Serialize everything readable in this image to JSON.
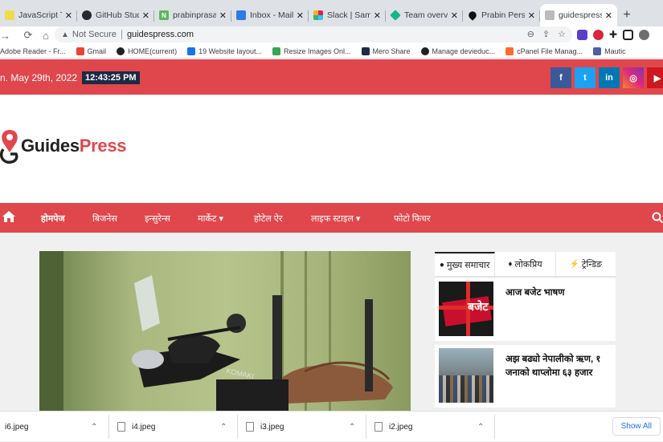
{
  "tabs": [
    {
      "title": "JavaScript Tu",
      "icon": "javascript-icon",
      "color": "#f0db4f"
    },
    {
      "title": "GitHub Stude",
      "icon": "github-icon",
      "color": "#24292e"
    },
    {
      "title": "prabinprasain",
      "icon": "notion-icon",
      "color": "#5cb85c"
    },
    {
      "title": "Inbox - Mail",
      "icon": "mail-icon",
      "color": "#2d7be5"
    },
    {
      "title": "Slack | Samye",
      "icon": "slack-icon",
      "color": "#e01e5a"
    },
    {
      "title": "Team overvie",
      "icon": "diamond-icon",
      "color": "#19b48a"
    },
    {
      "title": "Prabin Person",
      "icon": "drop-icon",
      "color": "#111111"
    },
    {
      "title": "guidespress.c",
      "icon": "guidespress-icon",
      "color": "#7a7a7a",
      "active": true
    }
  ],
  "address": {
    "security": "Not Secure",
    "url": "guidespress.com"
  },
  "bookmarks": [
    {
      "label": "Adobe Reader - Fr...",
      "color": "#d93025"
    },
    {
      "label": "Gmail",
      "color": "#ea4335"
    },
    {
      "label": "HOME(current)",
      "color": "#202124"
    },
    {
      "label": "19 Website layout...",
      "color": "#1a73e8"
    },
    {
      "label": "Resize Images Onl...",
      "color": "#34a853"
    },
    {
      "label": "Mero Share",
      "color": "#1c2a44"
    },
    {
      "label": "Manage devieduc...",
      "color": "#202124"
    },
    {
      "label": "cPanel File Manag...",
      "color": "#ff6c2c"
    },
    {
      "label": "Mautic",
      "color": "#4e5e9e"
    }
  ],
  "topbar": {
    "date": "n. May 29th, 2022",
    "time": "12:43:25 PM"
  },
  "social": [
    {
      "name": "facebook",
      "glyph": "f",
      "color": "#3b5998"
    },
    {
      "name": "twitter",
      "glyph": "t",
      "color": "#1da1f2"
    },
    {
      "name": "linkedin",
      "glyph": "in",
      "color": "#0077b5"
    },
    {
      "name": "instagram",
      "glyph": "◎",
      "color": "#c13584"
    },
    {
      "name": "youtube",
      "glyph": "▶",
      "color": "#cc181e"
    }
  ],
  "logo": {
    "part1": "Guides",
    "part2": "Press"
  },
  "nav": {
    "items": [
      {
        "label": "होमपेज",
        "bold": true
      },
      {
        "label": "बिजनेस"
      },
      {
        "label": "इन्सुरेन्स"
      },
      {
        "label": "मार्केट ▾"
      },
      {
        "label": "होटेल ऐर"
      },
      {
        "label": "लाइफ स्टाइल ▾"
      },
      {
        "label": "फोटो फिचर"
      }
    ]
  },
  "sidebar": {
    "tabs": [
      {
        "label": "मुख्य समाचार",
        "icon": "clock-icon"
      },
      {
        "label": "लोकप्रिय",
        "icon": "fire-icon"
      },
      {
        "label": "ट्रेन्डिङ",
        "icon": "bolt-icon"
      }
    ],
    "news": [
      {
        "title": "आज बजेट भाषण",
        "thumb_text": "बजेट"
      },
      {
        "title": "अझ बढ्यो नेपालीको ऋण, १ जनाको थाप्लोमा ६३ हजार"
      }
    ]
  },
  "downloads": {
    "files": [
      "i6.jpeg",
      "i4.jpeg",
      "i3.jpeg",
      "i2.jpeg"
    ],
    "show_all": "Show All"
  },
  "colors": {
    "brand_red": "#e0474c",
    "clock_bg": "#1c2a44"
  }
}
